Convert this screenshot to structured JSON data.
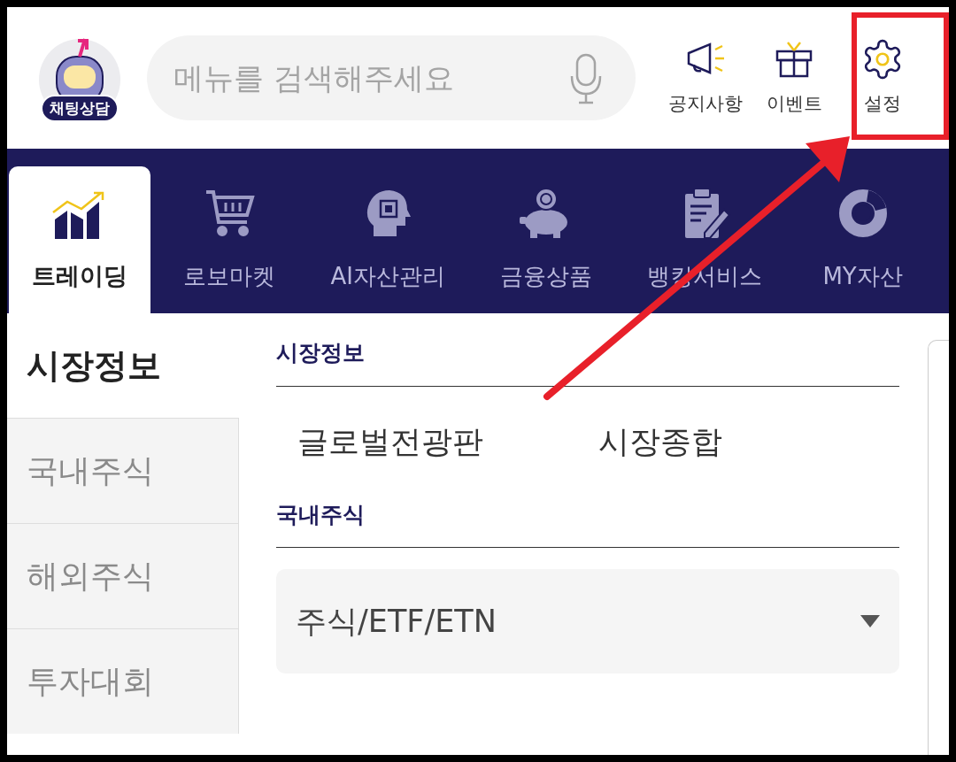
{
  "header": {
    "chat_badge": "채팅상담",
    "search": {
      "placeholder": "메뉴를 검색해주세요"
    },
    "actions": [
      {
        "kind": "megaphone",
        "label": "공지사항"
      },
      {
        "kind": "gift",
        "label": "이벤트"
      },
      {
        "kind": "gear",
        "label": "설정"
      }
    ]
  },
  "tabs": [
    {
      "kind": "chart",
      "label": "트레이딩",
      "selected": true
    },
    {
      "kind": "cart",
      "label": "로보마켓",
      "selected": false
    },
    {
      "kind": "brain",
      "label": "AI자산관리",
      "selected": false
    },
    {
      "kind": "piggy",
      "label": "금융상품",
      "selected": false
    },
    {
      "kind": "clipboard",
      "label": "뱅킹서비스",
      "selected": false
    },
    {
      "kind": "donut",
      "label": "MY자산",
      "selected": false
    }
  ],
  "sidebar": {
    "title": "시장정보",
    "items": [
      "국내주식",
      "해외주식",
      "투자대회"
    ]
  },
  "sections": [
    {
      "title": "시장정보",
      "links": [
        "글로벌전광판",
        "시장종합"
      ]
    },
    {
      "title": "국내주식",
      "dropdown": {
        "value": "주식/ETF/ETN"
      }
    }
  ]
}
